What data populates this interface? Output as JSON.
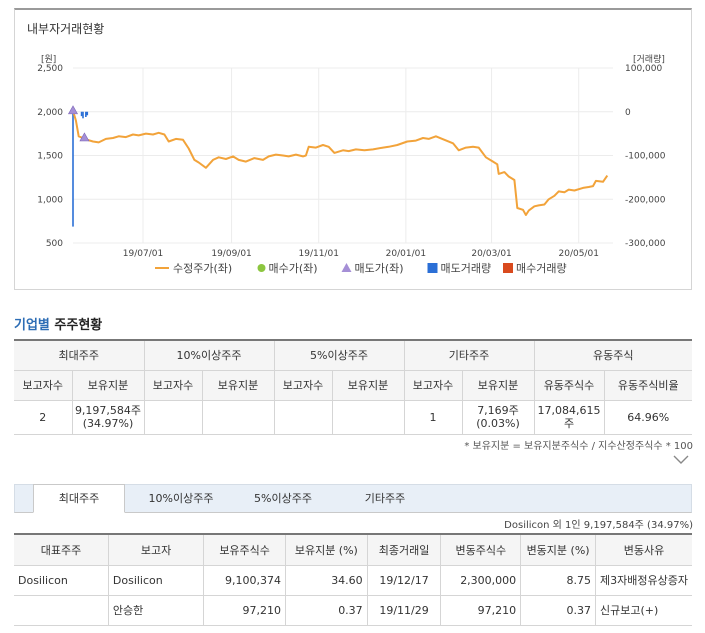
{
  "chart_panel": {
    "title": "내부자거래현황",
    "left_unit": "[원]",
    "right_unit": "[거래량]",
    "legend": [
      {
        "label": "수정주가(좌)",
        "color": "#f2a33a",
        "kind": "line"
      },
      {
        "label": "매수가(좌)",
        "color": "#8cc63f",
        "kind": "dot"
      },
      {
        "label": "매도가(좌)",
        "color": "#a58fd6",
        "kind": "triangle"
      },
      {
        "label": "매도거래량",
        "color": "#2b6fd6",
        "kind": "square"
      },
      {
        "label": "매수거래량",
        "color": "#d94a1e",
        "kind": "square"
      }
    ]
  },
  "chart_data": {
    "type": "line",
    "left_axis": {
      "ticks": [
        "2,500",
        "2,000",
        "1,500",
        "1,000",
        "500"
      ],
      "ylim": [
        500,
        2500
      ]
    },
    "right_axis": {
      "ticks": [
        "100,000",
        "0",
        "-100,000",
        "-200,000",
        "-300,000"
      ],
      "ylim": [
        -300000,
        100000
      ]
    },
    "x_ticks": [
      "19/07/01",
      "19/09/01",
      "19/11/01",
      "20/01/01",
      "20/03/01",
      "20/05/01"
    ],
    "x_tick_dates": [
      "2019-07-01",
      "2019-09-01",
      "2019-11-01",
      "2020-01-01",
      "2020-03-01",
      "2020-05-01"
    ],
    "x_range": [
      "2019-05-13",
      "2020-05-25"
    ],
    "series": [
      {
        "name": "수정주가(좌)",
        "color": "#f2a33a",
        "points": [
          [
            "2019-05-13",
            2010
          ],
          [
            "2019-05-15",
            1900
          ],
          [
            "2019-05-17",
            1720
          ],
          [
            "2019-05-20",
            1700
          ],
          [
            "2019-05-23",
            1680
          ],
          [
            "2019-05-27",
            1660
          ],
          [
            "2019-05-31",
            1650
          ],
          [
            "2019-06-05",
            1690
          ],
          [
            "2019-06-10",
            1700
          ],
          [
            "2019-06-14",
            1720
          ],
          [
            "2019-06-19",
            1710
          ],
          [
            "2019-06-24",
            1740
          ],
          [
            "2019-06-28",
            1730
          ],
          [
            "2019-07-03",
            1750
          ],
          [
            "2019-07-08",
            1740
          ],
          [
            "2019-07-12",
            1760
          ],
          [
            "2019-07-16",
            1740
          ],
          [
            "2019-07-19",
            1660
          ],
          [
            "2019-07-24",
            1690
          ],
          [
            "2019-07-29",
            1680
          ],
          [
            "2019-08-02",
            1580
          ],
          [
            "2019-08-06",
            1450
          ],
          [
            "2019-08-09",
            1420
          ],
          [
            "2019-08-14",
            1360
          ],
          [
            "2019-08-19",
            1450
          ],
          [
            "2019-08-23",
            1480
          ],
          [
            "2019-08-28",
            1460
          ],
          [
            "2019-09-02",
            1490
          ],
          [
            "2019-09-06",
            1450
          ],
          [
            "2019-09-11",
            1430
          ],
          [
            "2019-09-17",
            1470
          ],
          [
            "2019-09-23",
            1450
          ],
          [
            "2019-09-27",
            1490
          ],
          [
            "2019-10-02",
            1510
          ],
          [
            "2019-10-07",
            1500
          ],
          [
            "2019-10-11",
            1490
          ],
          [
            "2019-10-16",
            1510
          ],
          [
            "2019-10-21",
            1490
          ],
          [
            "2019-10-23",
            1500
          ],
          [
            "2019-10-25",
            1600
          ],
          [
            "2019-10-30",
            1590
          ],
          [
            "2019-11-04",
            1620
          ],
          [
            "2019-11-08",
            1600
          ],
          [
            "2019-11-12",
            1530
          ],
          [
            "2019-11-18",
            1560
          ],
          [
            "2019-11-22",
            1550
          ],
          [
            "2019-11-27",
            1570
          ],
          [
            "2019-12-03",
            1560
          ],
          [
            "2019-12-09",
            1570
          ],
          [
            "2019-12-16",
            1590
          ],
          [
            "2019-12-20",
            1600
          ],
          [
            "2019-12-26",
            1620
          ],
          [
            "2020-01-02",
            1660
          ],
          [
            "2020-01-08",
            1670
          ],
          [
            "2020-01-13",
            1700
          ],
          [
            "2020-01-17",
            1690
          ],
          [
            "2020-01-22",
            1720
          ],
          [
            "2020-01-28",
            1680
          ],
          [
            "2020-02-03",
            1640
          ],
          [
            "2020-02-07",
            1560
          ],
          [
            "2020-02-12",
            1590
          ],
          [
            "2020-02-17",
            1600
          ],
          [
            "2020-02-21",
            1590
          ],
          [
            "2020-02-26",
            1480
          ],
          [
            "2020-03-02",
            1430
          ],
          [
            "2020-03-05",
            1400
          ],
          [
            "2020-03-06",
            1290
          ],
          [
            "2020-03-10",
            1310
          ],
          [
            "2020-03-13",
            1260
          ],
          [
            "2020-03-17",
            1220
          ],
          [
            "2020-03-19",
            900
          ],
          [
            "2020-03-23",
            880
          ],
          [
            "2020-03-25",
            820
          ],
          [
            "2020-03-27",
            870
          ],
          [
            "2020-03-31",
            920
          ],
          [
            "2020-04-03",
            930
          ],
          [
            "2020-04-07",
            940
          ],
          [
            "2020-04-10",
            1000
          ],
          [
            "2020-04-14",
            1040
          ],
          [
            "2020-04-17",
            1090
          ],
          [
            "2020-04-21",
            1080
          ],
          [
            "2020-04-24",
            1110
          ],
          [
            "2020-04-28",
            1100
          ],
          [
            "2020-05-04",
            1130
          ],
          [
            "2020-05-08",
            1140
          ],
          [
            "2020-05-11",
            1150
          ],
          [
            "2020-05-13",
            1210
          ],
          [
            "2020-05-18",
            1200
          ],
          [
            "2020-05-21",
            1270
          ]
        ]
      },
      {
        "name": "매도가(좌)",
        "color": "#a58fd6",
        "points": [
          [
            "2019-05-13",
            2010
          ],
          [
            "2019-05-21",
            1700
          ]
        ]
      },
      {
        "name": "매도거래량",
        "color": "#2b6fd6",
        "points": [
          [
            "2019-05-13",
            -262500
          ],
          [
            "2019-05-19",
            -10000
          ],
          [
            "2019-05-20",
            -15000
          ],
          [
            "2019-05-22",
            -12000
          ],
          [
            "2019-05-23",
            -8000
          ]
        ]
      }
    ]
  },
  "section": {
    "prefix": "기업별",
    "title": "주주현황"
  },
  "summary_table": {
    "groups": [
      "최대주주",
      "10%이상주주",
      "5%이상주주",
      "기타주주",
      "유동주식"
    ],
    "subheaders": [
      "보고자수",
      "보유지분",
      "보고자수",
      "보유지분",
      "보고자수",
      "보유지분",
      "보고자수",
      "보유지분",
      "유동주식수",
      "유동주식비율"
    ],
    "row": {
      "max_count": "2",
      "max_stake": "9,197,584주",
      "max_pct": "(34.97%)",
      "ten_count": "",
      "ten_stake": "",
      "five_count": "",
      "five_stake": "",
      "other_count": "1",
      "other_stake": "7,169주",
      "other_pct": "(0.03%)",
      "float_shares": "17,084,615주",
      "float_ratio": "64.96%"
    }
  },
  "footnote": "* 보유지분 = 보유지분주식수 / 지수산정주식수 * 100",
  "tabs": [
    {
      "label": "최대주주",
      "active": true
    },
    {
      "label": "10%이상주주",
      "active": false
    },
    {
      "label": "5%이상주주",
      "active": false
    },
    {
      "label": "기타주주",
      "active": false
    }
  ],
  "detail_summary": "Dosilicon 외 1인  9,197,584주 (34.97%)",
  "detail_table": {
    "headers": [
      "대표주주",
      "보고자",
      "보유주식수",
      "보유지분 (%)",
      "최종거래일",
      "변동주식수",
      "변동지분 (%)",
      "변동사유"
    ],
    "rows": [
      {
        "rep": "Dosilicon",
        "reporter": "Dosilicon",
        "shares": "9,100,374",
        "pct": "34.60",
        "last_date": "19/12/17",
        "change_shares": "2,300,000",
        "change_pct": "8.75",
        "reason": "제3자배정유상증자"
      },
      {
        "rep": "",
        "reporter": "안승한",
        "shares": "97,210",
        "pct": "0.37",
        "last_date": "19/11/29",
        "change_shares": "97,210",
        "change_pct": "0.37",
        "reason": "신규보고(+)"
      }
    ]
  }
}
